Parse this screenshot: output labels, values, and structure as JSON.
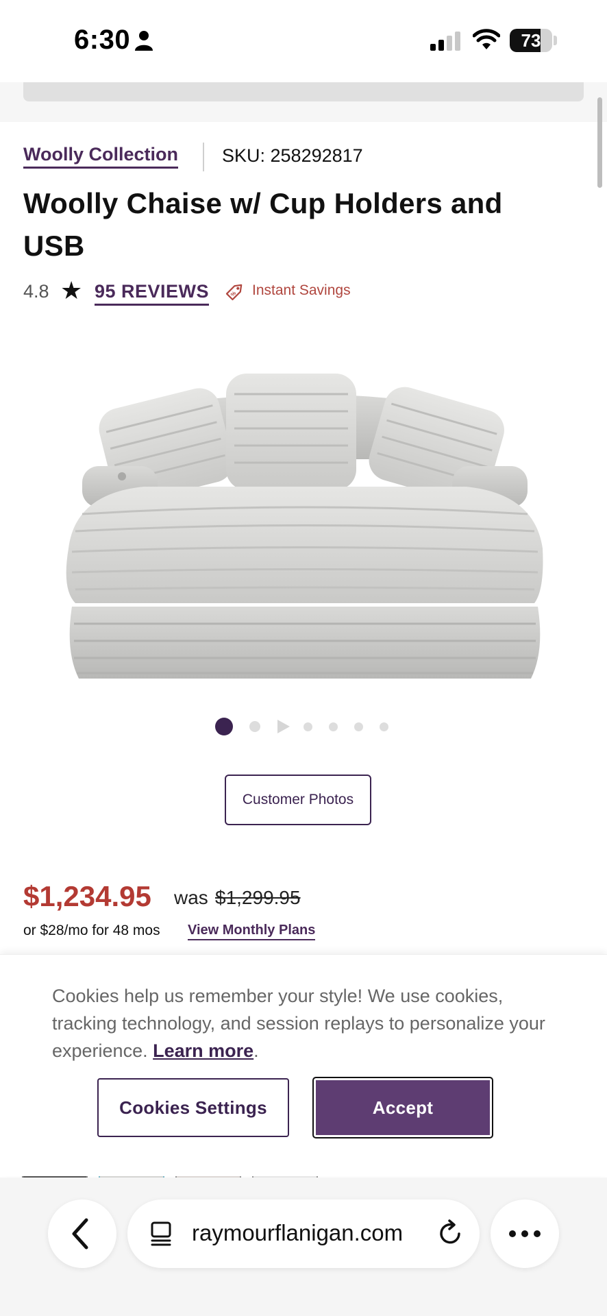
{
  "status_bar": {
    "time": "6:30",
    "battery": "73",
    "battery_level": 0.73
  },
  "product": {
    "collection": "Woolly Collection",
    "sku": "SKU: 258292817",
    "title": "Woolly Chaise w/ Cup Holders and USB",
    "rating": "4.8",
    "reviews": "95 REVIEWS",
    "badge": "Instant Savings",
    "image_alt": "woolly-chaise-product-image"
  },
  "carousel": {
    "count": 7,
    "active_index": 0,
    "video_index": 2
  },
  "customer_photos_label": "Customer Photos",
  "pricing": {
    "price": "$1,234.95",
    "was_label": "was",
    "was_price": "$1,299.95",
    "monthly": "or $28/mo for 48 mos",
    "monthly_link": "View Monthly Plans"
  },
  "cookie_banner": {
    "text": "Cookies help us remember your style! We use cookies, tracking technology, and session replays to personalize your experience.",
    "learn_more": "Learn more",
    "period": ".",
    "settings_label": "Cookies Settings",
    "accept_label": "Accept"
  },
  "browser": {
    "url": "raymourflanigan.com"
  },
  "colors": {
    "brand_purple": "#4a2a5a",
    "accept_purple": "#5e3d72",
    "price_red": "#b33a33",
    "savings_red": "#b0463e"
  }
}
